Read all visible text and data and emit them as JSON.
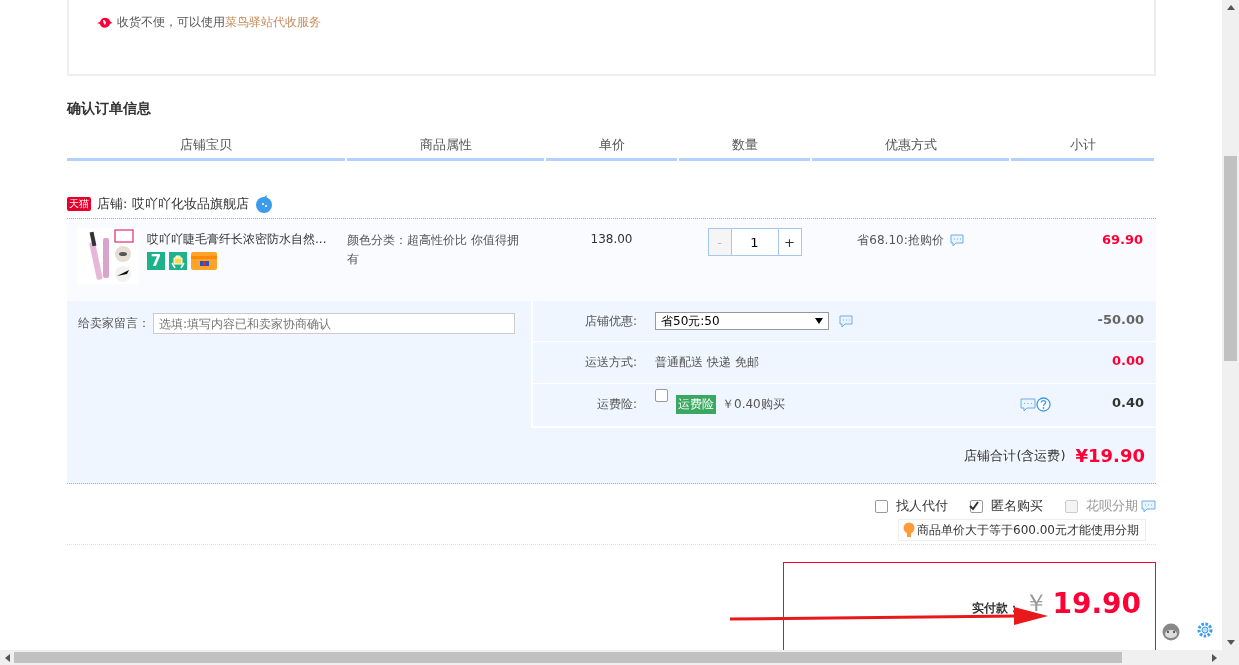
{
  "delivery_notice": {
    "text": "收货不便，可以使用",
    "link": "菜鸟驿站代收服务"
  },
  "section_title": "确认订单信息",
  "columns": [
    "店铺宝贝",
    "商品属性",
    "单价",
    "数量",
    "优惠方式",
    "小计"
  ],
  "shop": {
    "badge": "天猫",
    "name": "店铺: 哎吖吖化妆品旗舰店"
  },
  "item": {
    "title": "哎吖吖睫毛膏纤长浓密防水自然...",
    "service_badge": "7",
    "attribute": "颜色分类：超高性价比 你值得拥有",
    "price": "138.00",
    "decrement": "-",
    "quantity": "1",
    "increment": "+",
    "discount": "省68.10:抢购价",
    "subtotal": "69.90"
  },
  "message": {
    "label": "给卖家留言：",
    "placeholder": "选填:填写内容已和卖家协商确认"
  },
  "fees": [
    {
      "kind": "select",
      "label": "店铺优惠:",
      "value": "省50元:50",
      "amount": "-50.00",
      "color": "#666666"
    },
    {
      "kind": "text",
      "label": "运送方式:",
      "value": "普通配送 快递 免邮",
      "amount": "0.00",
      "color": "#ff0036"
    },
    {
      "kind": "insurance",
      "label": "运费险:",
      "checked": false,
      "badge": "运费险",
      "value": "￥0.40购买",
      "amount": "0.40",
      "color": "#333333"
    }
  ],
  "shop_total": {
    "label": "店铺合计(含运费)",
    "amount": "¥19.90"
  },
  "options": [
    {
      "label": "找人代付",
      "checked": false,
      "disabled": false,
      "info": false
    },
    {
      "label": "匿名购买",
      "checked": true,
      "disabled": false,
      "info": false
    },
    {
      "label": "花呗分期",
      "checked": false,
      "disabled": true,
      "info": true
    }
  ],
  "installment_hint": "商品单价大于等于600.00元才能使用分期",
  "payment": {
    "label": "实付款：",
    "currency": "￥",
    "amount": "19.90"
  }
}
